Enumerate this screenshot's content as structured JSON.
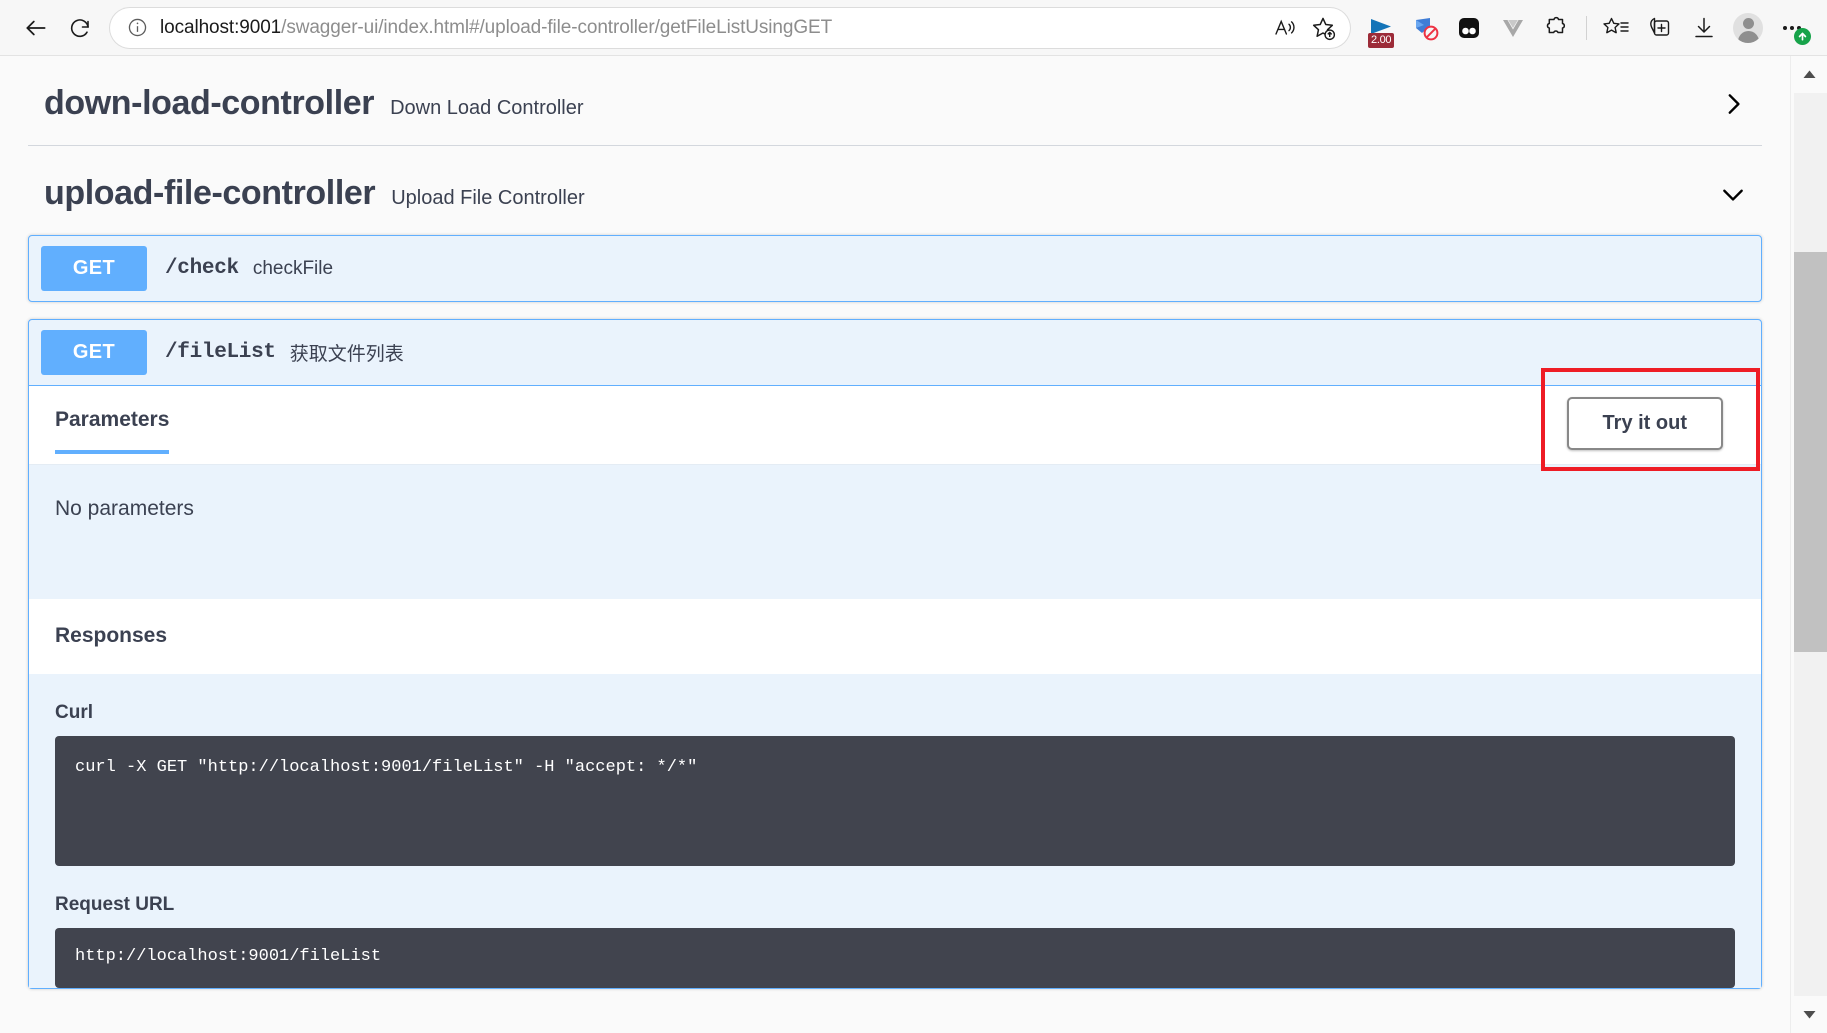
{
  "browser": {
    "back_tooltip": "Back",
    "refresh_tooltip": "Refresh",
    "url_host": "localhost:9001",
    "url_path": "/swagger-ui/index.html#/upload-file-controller/getFileListUsingGET",
    "read_aloud_tooltip": "Read aloud",
    "add_favorite_tooltip": "Add this page to favorites",
    "extensions": [
      {
        "name": "video-speed-controller-extension",
        "badge": "2.00"
      },
      {
        "name": "adblock-extension",
        "badge": ""
      },
      {
        "name": "dark-reader-extension",
        "badge": ""
      },
      {
        "name": "vue-devtools-extension",
        "badge": ""
      },
      {
        "name": "puzzle-extension",
        "badge": ""
      }
    ],
    "favorites_tooltip": "Favorites",
    "collections_tooltip": "Collections",
    "downloads_tooltip": "Downloads",
    "profile_tooltip": "Profile",
    "settings_tooltip": "Settings and more"
  },
  "swagger": {
    "tags": [
      {
        "name": "down-load-controller",
        "description": "Down Load Controller",
        "expanded": false,
        "chevron": "chevron-right-icon"
      },
      {
        "name": "upload-file-controller",
        "description": "Upload File Controller",
        "expanded": true,
        "chevron": "chevron-down-icon"
      }
    ],
    "operations": [
      {
        "method": "GET",
        "path": "/check",
        "summary": "checkFile",
        "expanded": false
      },
      {
        "method": "GET",
        "path": "/fileList",
        "summary": "获取文件列表",
        "expanded": true
      }
    ],
    "detail": {
      "parameters_tab": "Parameters",
      "try_it_out_label": "Try it out",
      "no_parameters_text": "No parameters",
      "responses_heading": "Responses",
      "curl_label": "Curl",
      "curl_command": "curl -X GET \"http://localhost:9001/fileList\" -H \"accept: */*\"",
      "request_url_label": "Request URL",
      "request_url_value": "http://localhost:9001/fileList"
    }
  },
  "annotation": {
    "target": "try-it-out-button",
    "color": "#ee1c25"
  },
  "colors": {
    "get_method": "#61affe",
    "op_background": "#eaf3fc",
    "code_background": "#41444e",
    "text": "#3b4151"
  }
}
